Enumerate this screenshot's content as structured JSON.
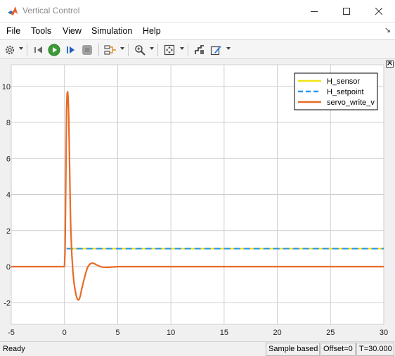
{
  "window": {
    "title": "Vertical Control",
    "controls": {
      "minimize": "minimize-icon",
      "maximize": "maximize-icon",
      "close": "close-icon"
    }
  },
  "menu": {
    "items": [
      "File",
      "Tools",
      "View",
      "Simulation",
      "Help"
    ]
  },
  "toolbar": {
    "icons": [
      "settings-gear-icon",
      "restore-icon",
      "run-icon",
      "step-forward-icon",
      "stop-icon",
      "signal-selector-icon",
      "zoom-icon",
      "fit-to-view-icon",
      "highlight-icon",
      "style-edit-icon"
    ],
    "colors": {
      "run": "#3a9b35",
      "step": "#1f5fbf",
      "stop": "#a0a0a0"
    }
  },
  "status": {
    "ready": "Ready",
    "sample_based": "Sample based",
    "offset": "Offset=0",
    "time": "T=30.000"
  },
  "chart_data": {
    "type": "line",
    "title": "",
    "xlabel": "",
    "ylabel": "",
    "xlim": [
      -5,
      30
    ],
    "ylim": [
      -3.2,
      11.2
    ],
    "xticks": [
      -5,
      0,
      5,
      10,
      15,
      20,
      25,
      30
    ],
    "yticks": [
      -2,
      0,
      2,
      4,
      6,
      8,
      10
    ],
    "grid": true,
    "legend_position": "top-right",
    "background": "#ffffff",
    "grid_color": "#cfcfcf",
    "series": [
      {
        "name": "H_sensor",
        "color": "#f2e30f",
        "style": "solid",
        "x": [
          0.2,
          30
        ],
        "y": [
          1,
          1
        ]
      },
      {
        "name": "H_setpoint",
        "color": "#2f97e8",
        "style": "dashed",
        "x": [
          0.2,
          30
        ],
        "y": [
          1,
          1
        ]
      },
      {
        "name": "servo_write_v",
        "color": "#ea6a24",
        "style": "solid",
        "x": [
          -5,
          0.0,
          0.05,
          0.1,
          0.15,
          0.2,
          0.25,
          0.3,
          0.35,
          0.4,
          0.45,
          0.5,
          0.55,
          0.6,
          0.7,
          0.8,
          0.9,
          1.0,
          1.1,
          1.2,
          1.3,
          1.4,
          1.5,
          1.6,
          1.8,
          2.0,
          2.2,
          2.4,
          2.6,
          2.8,
          3.0,
          3.3,
          3.6,
          4.0,
          4.5,
          5.0,
          6.0,
          30
        ],
        "y": [
          0,
          0,
          0.8,
          3.0,
          6.2,
          8.7,
          9.6,
          9.7,
          9.3,
          8.3,
          6.8,
          5.0,
          3.3,
          2.0,
          0.6,
          -0.3,
          -0.9,
          -1.3,
          -1.6,
          -1.8,
          -1.85,
          -1.8,
          -1.6,
          -1.3,
          -0.8,
          -0.35,
          0.0,
          0.15,
          0.2,
          0.17,
          0.1,
          0.02,
          -0.03,
          -0.04,
          -0.02,
          0.0,
          0.0,
          0.0
        ]
      }
    ]
  }
}
